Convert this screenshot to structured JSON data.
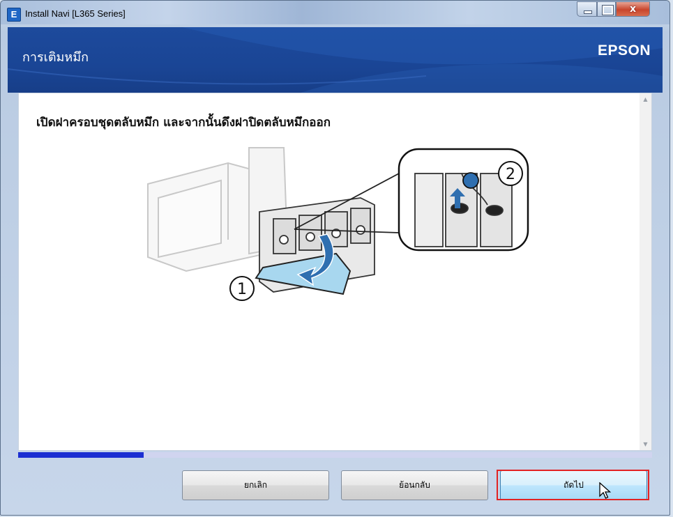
{
  "window": {
    "title": "Install Navi [L365 Series]",
    "app_icon_letter": "E",
    "controls": {
      "close_glyph": "x"
    }
  },
  "header": {
    "title": "การเติมหมึก",
    "brand": "EPSON"
  },
  "content": {
    "instruction": "เปิดฝาครอบชุดตลับหมึก และจากนั้นดึงฝาปิดตลับหมึกออก",
    "illustration": {
      "step_1_label": "1",
      "step_2_label": "2"
    }
  },
  "progress": {
    "fraction": 0.198
  },
  "buttons": {
    "cancel": "ยกเลิก",
    "back": "ย้อนกลับ",
    "next": "ถัดไป"
  },
  "colors": {
    "header_bg": "#1a4595",
    "progress_fill": "#1c2fd2",
    "progress_track": "#d0d4ef",
    "highlight": "#e22222",
    "arrow": "#2f6fb0"
  }
}
